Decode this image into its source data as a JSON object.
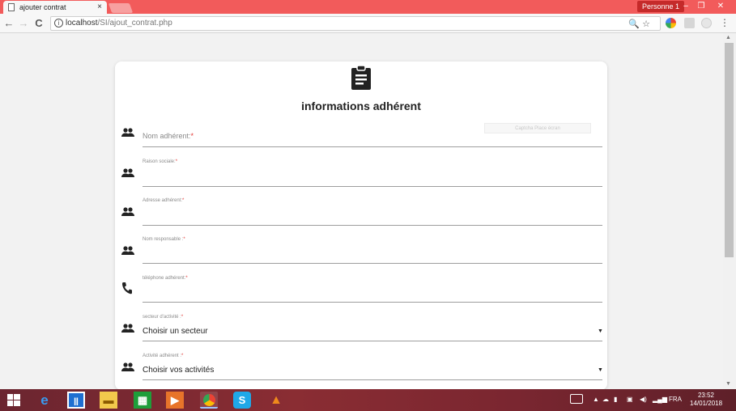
{
  "browser": {
    "tab_title": "ajouter contrat",
    "tab_close": "×",
    "profile": "Personne 1",
    "url_host": "localhost",
    "url_path": "/SI/ajout_contrat.php",
    "info_glyph": "i",
    "window_controls": [
      "–",
      "❐",
      "✕"
    ],
    "nav": {
      "back": "←",
      "forward": "→",
      "reload": "C"
    },
    "omnibox_icons": [
      "🔍",
      "☆"
    ],
    "menu": "⋮"
  },
  "form": {
    "icon": "clipboard-icon",
    "title": "informations adhérent",
    "captcha_text": "Captcha Place écran",
    "required_mark": "*",
    "fields": [
      {
        "label": "Nom adhérent:",
        "icon": "people-icon"
      },
      {
        "label": "Raison sociale:",
        "icon": "people-icon"
      },
      {
        "label": "Adresse adhérent:",
        "icon": "people-icon"
      },
      {
        "label": "Nom responsable :",
        "icon": "people-icon"
      },
      {
        "label": "téléphone adhérent:",
        "icon": "phone-icon"
      },
      {
        "label": "secteur d'activité :",
        "icon": "people-icon",
        "value": "Choisir un secteur"
      },
      {
        "label": "Activité adhérent :",
        "icon": "people-icon",
        "value": "Choisir vos activités"
      }
    ]
  },
  "taskbar": {
    "language": "FRA",
    "time": "23:52",
    "date": "14/01/2018",
    "items": [
      "windows-start-icon",
      "edge-icon",
      "app-icon",
      "file-explorer-icon",
      "store-icon",
      "media-player-icon",
      "chrome-icon",
      "skype-icon",
      "vlc-icon"
    ]
  },
  "colors": {
    "titlebar": "#f25b5b",
    "required": "#e53935",
    "taskbar": "#7a2630"
  }
}
